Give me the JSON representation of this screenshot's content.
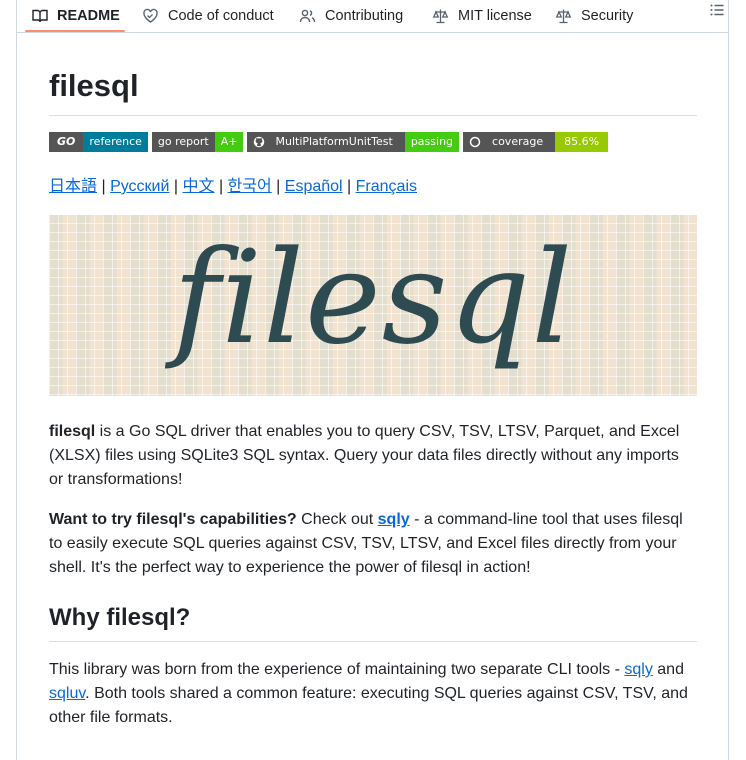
{
  "tabs": [
    {
      "label": "README",
      "icon": "book-icon"
    },
    {
      "label": "Code of conduct",
      "icon": "heart-handshake-icon"
    },
    {
      "label": "Contributing",
      "icon": "people-icon"
    },
    {
      "label": "MIT license",
      "icon": "scale-icon"
    },
    {
      "label": "Security",
      "icon": "scale-icon"
    }
  ],
  "outline_icon": "list-icon",
  "title": "filesql",
  "badges": [
    {
      "left": "GO",
      "right": "reference",
      "left_color": "#555555",
      "right_color": "#007d9c"
    },
    {
      "left": "go report",
      "right": "A+",
      "left_color": "#555555",
      "right_color": "#44cc11"
    },
    {
      "left": "MultiPlatformUnitTest",
      "right": "passing",
      "left_color": "#555555",
      "right_color": "#44cc11"
    },
    {
      "left": "coverage",
      "right": "85.6%",
      "left_color": "#555555",
      "right_color": "#97ca00"
    }
  ],
  "languages": [
    "日本語",
    "Русский",
    "中文",
    "한국어",
    "Español",
    "Français"
  ],
  "banner_text": "filesql",
  "intro": {
    "bold": "filesql",
    "text": " is a Go SQL driver that enables you to query CSV, TSV, LTSV, Parquet, and Excel (XLSX) files using SQLite3 SQL syntax. Query your data files directly without any imports or transformations!"
  },
  "try": {
    "bold": "Want to try filesql's capabilities?",
    "pre": " Check out ",
    "link": "sqly",
    "post": " - a command-line tool that uses filesql to easily execute SQL queries against CSV, TSV, LTSV, and Excel files directly from your shell. It's the perfect way to experience the power of filesql in action!"
  },
  "why_heading": "Why filesql?",
  "why": {
    "pre": "This library was born from the experience of maintaining two separate CLI tools - ",
    "link1": "sqly",
    "mid1": " and ",
    "link2": "sqluv",
    "post": ". Both tools shared a common feature: executing SQL queries against CSV, TSV, and other file formats."
  },
  "colors": {
    "accent": "#fd8c73",
    "link": "#0969da",
    "text": "#1f2328"
  }
}
